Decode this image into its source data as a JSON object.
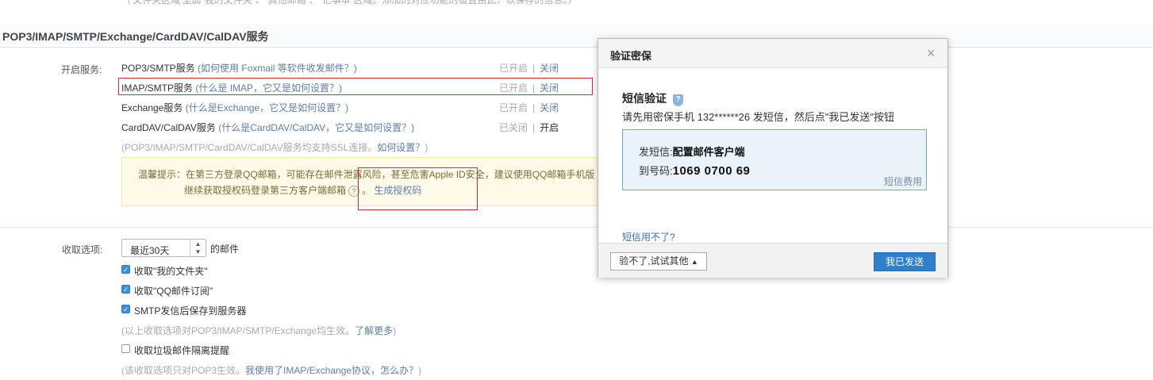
{
  "top_cut_text": "（'文件夹区域'里面“我的文件夹”、“其他邮箱”、“记事本”区域。添加的对应功能的设置由此，以保存的信息。）",
  "section": {
    "title": "POP3/IMAP/SMTP/Exchange/CardDAV/CalDAV服务"
  },
  "services": {
    "label": "开启服务:",
    "items": [
      {
        "name": "POP3/SMTP服务",
        "hint": "(如何使用 Foxmail 等软件收发邮件？)",
        "state": "已开启",
        "action": "关闭"
      },
      {
        "name": "IMAP/SMTP服务",
        "hint": "(什么是 IMAP，它又是如何设置？)",
        "state": "已开启",
        "action": "关闭"
      },
      {
        "name": "Exchange服务",
        "hint": "(什么是Exchange，它又是如何设置？)",
        "state": "已开启",
        "action": "关闭"
      },
      {
        "name": "CardDAV/CalDAV服务",
        "hint": "(什么是CardDAV/CalDAV，它又是如何设置？)",
        "state": "已关闭",
        "action": "开启"
      }
    ],
    "ssl_note_prefix": "(POP3/IMAP/SMTP/CardDAV/CalDAV服务均支持SSL连接。",
    "ssl_note_link": "如何设置？",
    "ssl_note_suffix": ")"
  },
  "tips": {
    "line1": "温馨提示：在第三方登录QQ邮箱，可能存在邮件泄露风险，甚至危害Apple ID安全，建议使用QQ邮箱手机版",
    "line2_prefix": "继续获取授权码登录第三方客户端邮箱",
    "help_glyph": "?",
    "line2_sep": "。",
    "generate_link": "生成授权码"
  },
  "fetch": {
    "label": "收取选项:",
    "select_value": "最近30天",
    "select_suffix": "的邮件",
    "options": [
      {
        "label": "收取\"我的文件夹\"",
        "checked": true
      },
      {
        "label": "收取\"QQ邮件订阅\"",
        "checked": true
      },
      {
        "label": "SMTP发信后保存到服务器",
        "checked": true
      }
    ],
    "note1_prefix": "(以上收取选项对POP3/IMAP/SMTP/Exchange均生效。",
    "note1_link": "了解更多",
    "note1_suffix": ")",
    "spam_label": "收取垃圾邮件隔离提醒",
    "note2_prefix": "(该收取选项只对POP3生效。",
    "note2_link": "我使用了IMAP/Exchange协议，怎么办？",
    "note2_suffix": ")"
  },
  "dialog": {
    "title": "验证密保",
    "close_glyph": "×",
    "heading": "短信验证",
    "shield_glyph": "?",
    "desc": "请先用密保手机 132******26 发短信，然后点\"我已发送\"按钮",
    "sms_label": "发短信:",
    "sms_content": "配置邮件客户端",
    "to_label": "到号码:",
    "to_number": "1069 0700 69",
    "fee_link": "短信费用",
    "unable_link": "短信用不了?",
    "alt_button": "验不了,试试其他",
    "alt_arrow": "▲",
    "send_button": "我已发送"
  },
  "colors": {
    "accent": "#2f7fd0",
    "highlight": "#d9282f",
    "link": "#5f7fa5"
  }
}
